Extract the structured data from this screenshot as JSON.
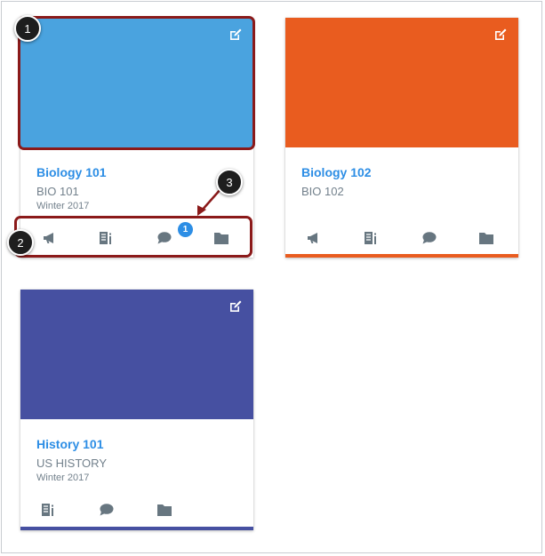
{
  "colors": {
    "biology101": "#4aa3df",
    "biology102": "#e95c1f",
    "history101": "#4650a1",
    "link": "#2d8ee5",
    "muted": "#73818c",
    "icon": "#677680",
    "annotation": "#8b1a1a"
  },
  "cards": [
    {
      "title": "Biology 101",
      "code": "BIO 101",
      "term": "Winter 2017",
      "actions": [
        "announcements-icon",
        "assignments-icon",
        "discussions-icon",
        "files-icon"
      ],
      "discussion_badge": "1"
    },
    {
      "title": "Biology 102",
      "code": "BIO 102",
      "term": "",
      "actions": [
        "announcements-icon",
        "assignments-icon",
        "discussions-icon",
        "files-icon"
      ]
    },
    {
      "title": "History 101",
      "code": "US HISTORY",
      "term": "Winter 2017",
      "actions": [
        "assignments-icon",
        "discussions-icon",
        "files-icon"
      ]
    }
  ],
  "callouts": [
    "1",
    "2",
    "3"
  ]
}
